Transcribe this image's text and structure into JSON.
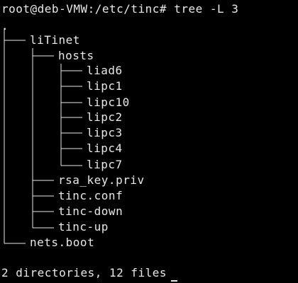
{
  "terminal": {
    "prompt_command": "root@deb-VMW:/etc/tinc# tree -L 3",
    "root": ".",
    "entries": {
      "litinet": "liTinet",
      "hosts": "hosts",
      "liad6": "liad6",
      "lipc1": "lipc1",
      "lipc10": "lipc10",
      "lipc2": "lipc2",
      "lipc3": "lipc3",
      "lipc4": "lipc4",
      "lipc7": "lipc7",
      "rsa_key": "rsa_key.priv",
      "tinc_conf": "tinc.conf",
      "tinc_down": "tinc-down",
      "tinc_up": "tinc-up",
      "nets_boot": "nets.boot"
    },
    "summary": "2 directories, 12 files"
  }
}
